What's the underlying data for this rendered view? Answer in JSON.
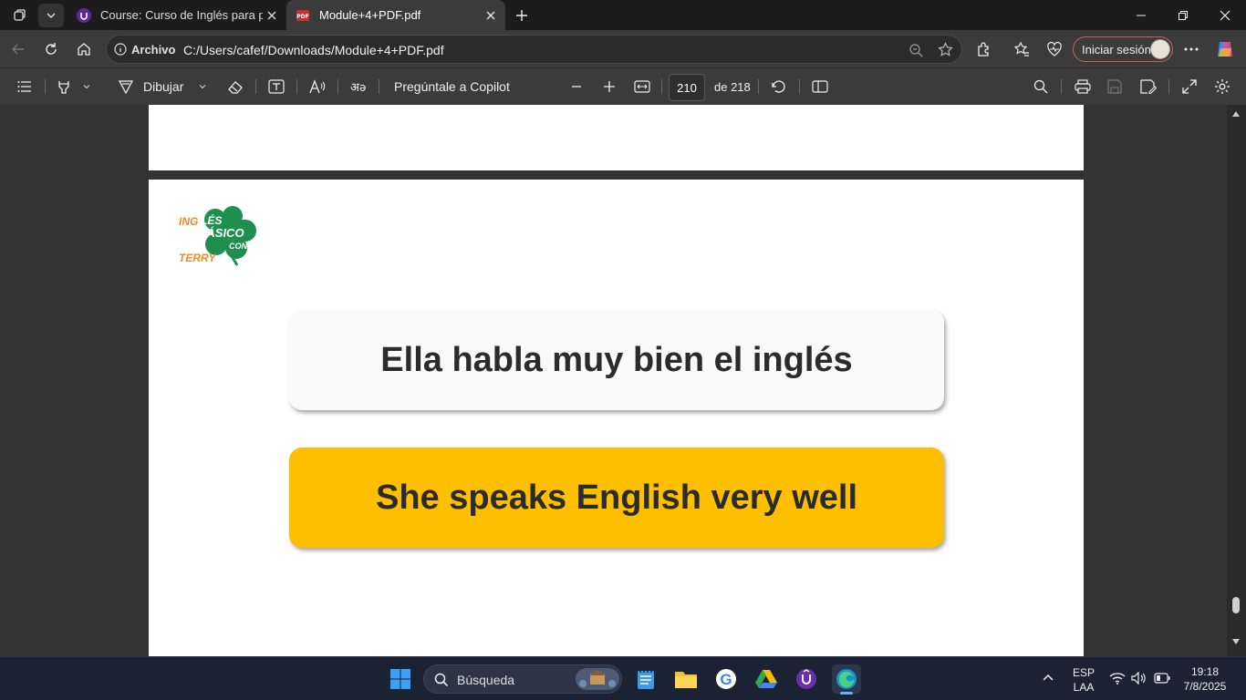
{
  "titlebar": {
    "tabs": [
      {
        "label": "Course: Curso de Inglés para prin",
        "icon": "udemy-icon"
      },
      {
        "label": "Module+4+PDF.pdf",
        "icon": "pdf-icon"
      }
    ]
  },
  "address": {
    "scheme_label": "Archivo",
    "url": "C:/Users/cafef/Downloads/Module+4+PDF.pdf",
    "signin_label": "Iniciar sesión"
  },
  "pdf_toolbar": {
    "draw_label": "Dibujar",
    "copilot_label": "Pregúntale a Copilot",
    "page_number": "210",
    "page_total": "de 218"
  },
  "document": {
    "logo_text": [
      "INGLÉS",
      "BÁSICO",
      "CON",
      "TERRY"
    ],
    "spanish_sentence": "Ella habla muy bien el inglés",
    "english_sentence": "She speaks English very well"
  },
  "taskbar": {
    "search_placeholder": "Búsqueda",
    "lang_top": "ESP",
    "lang_bottom": "LAA",
    "time": "19:18",
    "date": "7/8/2025"
  },
  "colors": {
    "accent_yellow": "#fdbf00",
    "logo_green": "#1e8f4e",
    "logo_orange": "#f08a24"
  }
}
